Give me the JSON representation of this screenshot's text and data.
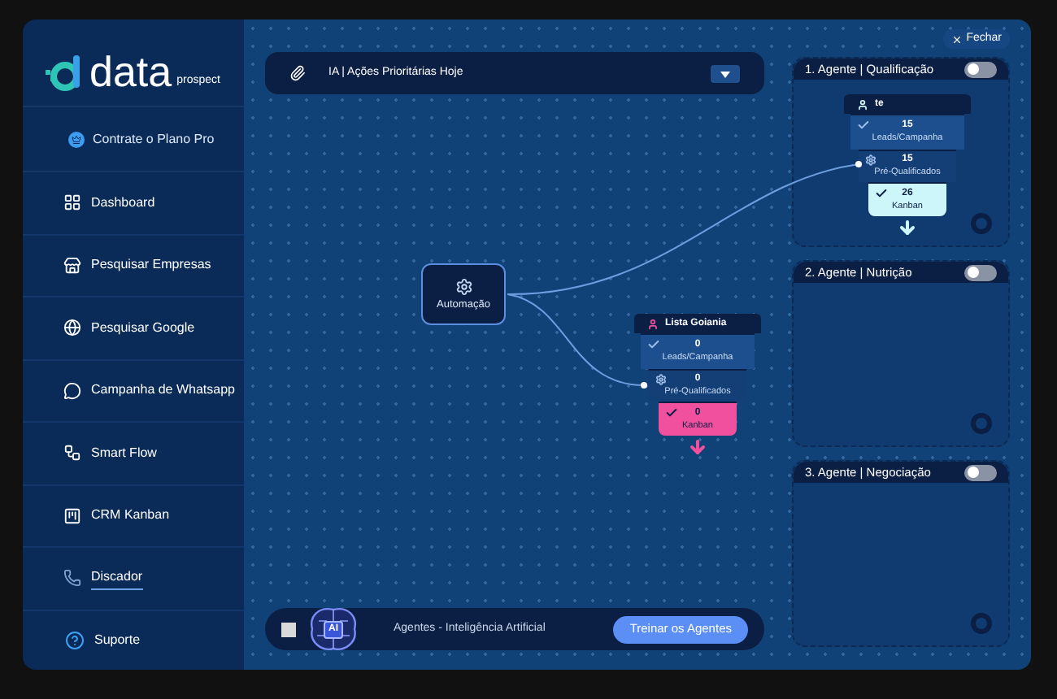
{
  "sidebar": {
    "brand": {
      "name": "data",
      "suffix": "prospect"
    },
    "promo": "Contrate o Plano Pro",
    "items": [
      {
        "label": "Dashboard",
        "selected": false
      },
      {
        "label": "Pesquisar Empresas",
        "selected": false
      },
      {
        "label": "Pesquisar Google",
        "selected": false
      },
      {
        "label": "Campanha de Whatsapp",
        "selected": false
      },
      {
        "label": "Smart Flow",
        "selected": false
      },
      {
        "label": "CRM Kanban",
        "selected": false
      },
      {
        "label": "Discador",
        "selected": true
      }
    ],
    "support": "Suporte"
  },
  "flow_selector": {
    "value": "IA | Ações Prioritárias Hoje"
  },
  "automation_node": {
    "label": "Automação"
  },
  "canvas_funnel": {
    "title": "Lista Goiania",
    "color": "#f0509e",
    "stages": [
      {
        "kind": "check",
        "count": "0",
        "label": "Leads/Campanha"
      },
      {
        "kind": "gear",
        "count": "0",
        "label": "Pré-Qualificados"
      },
      {
        "kind": "check",
        "count": "0",
        "label": "Kanban"
      }
    ]
  },
  "close_button": "Fechar",
  "agents": [
    {
      "title": "1. Agente | Qualificação",
      "on": false,
      "funnel": {
        "title": "te",
        "color": "#cdf6fb",
        "stages": [
          {
            "kind": "check",
            "count": "15",
            "label": "Leads/Campanha"
          },
          {
            "kind": "gear",
            "count": "15",
            "label": "Pré-Qualificados"
          },
          {
            "kind": "check",
            "count": "26",
            "label": "Kanban"
          }
        ]
      }
    },
    {
      "title": "2. Agente | Nutrição",
      "on": false
    },
    {
      "title": "3. Agente | Negociação",
      "on": false
    }
  ],
  "training_bar": {
    "checked": false,
    "ai_badge": "AI",
    "label": "Agentes - Inteligência Artificial",
    "button": "Treinar os Agentes"
  }
}
